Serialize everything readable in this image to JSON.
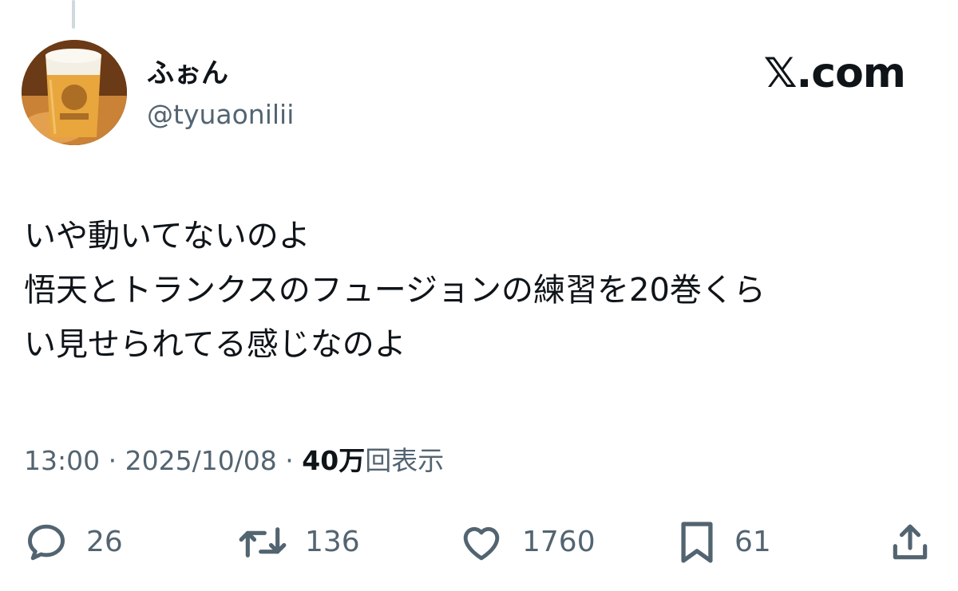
{
  "user": {
    "display_name": "ふぉん",
    "handle": "@tyuaonilii",
    "avatar_icon": "beer-glass-avatar"
  },
  "brand": {
    "label": "𝕏.com"
  },
  "tweet": {
    "lines": [
      "いや動いてないのよ",
      "悟天とトランクスのフュージョンの練習を20巻くら",
      "い見せられてる感じなのよ"
    ]
  },
  "meta": {
    "time": "13:00",
    "separator": " · ",
    "date": "2025/10/08",
    "views_count": "40万",
    "views_label": "回表示"
  },
  "actions": {
    "reply": {
      "icon": "reply-icon",
      "count": "26"
    },
    "retweet": {
      "icon": "retweet-icon",
      "count": "136"
    },
    "like": {
      "icon": "heart-icon",
      "count": "1760"
    },
    "bookmark": {
      "icon": "bookmark-icon",
      "count": "61"
    },
    "share": {
      "icon": "share-icon"
    }
  },
  "colors": {
    "text": "#0f1419",
    "secondary": "#536471",
    "thread_line": "#cfd9de"
  }
}
